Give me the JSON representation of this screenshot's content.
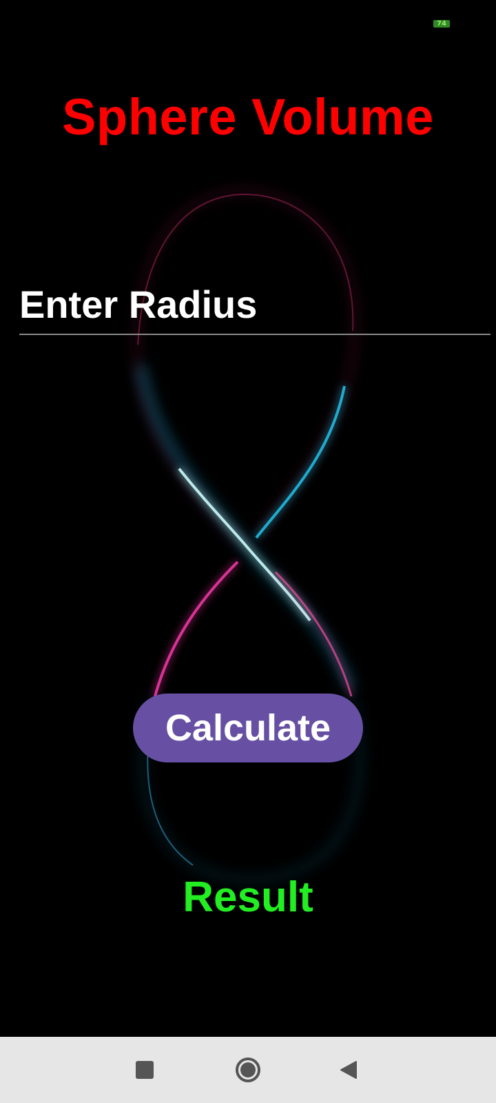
{
  "status_bar": {
    "battery_level": "74"
  },
  "app": {
    "title": "Sphere Volume",
    "radius_input": {
      "value": "",
      "placeholder": "Enter Radius"
    },
    "calculate_label": "Calculate",
    "result_text": "Result"
  },
  "navigation": {
    "recents_icon": "square-recents-icon",
    "home_icon": "circle-home-icon",
    "back_icon": "triangle-back-icon"
  },
  "colors": {
    "background": "#000000",
    "title": "#ff0000",
    "input_text": "#ffffff",
    "button": "#6750a4",
    "result": "#22ee22",
    "nav_bar": "#e6e6e6"
  }
}
